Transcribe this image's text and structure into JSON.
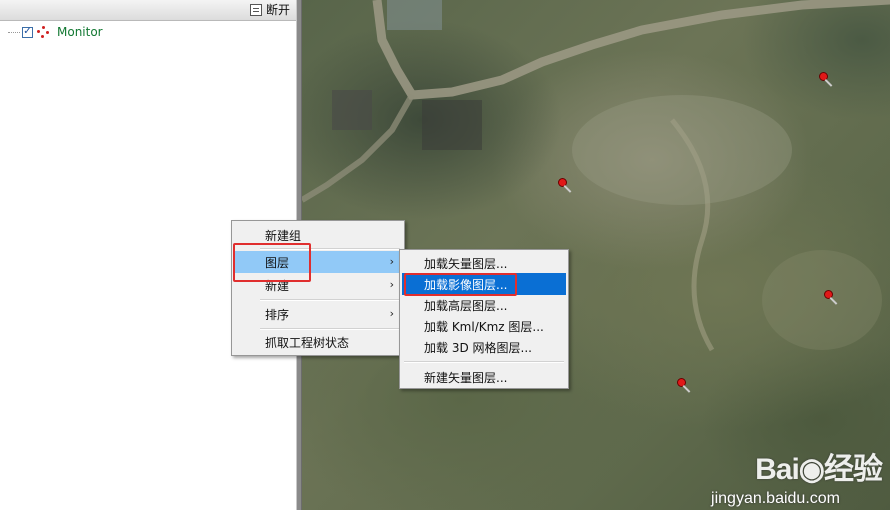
{
  "toolbar": {
    "disconnect_label": "断开"
  },
  "tree": {
    "node_label": "Monitor",
    "checked": true
  },
  "context_menu": {
    "items": [
      {
        "label": "新建组",
        "has_submenu": false
      },
      {
        "label": "图层",
        "has_submenu": true,
        "state": "highlighted"
      },
      {
        "label": "新建",
        "has_submenu": true
      },
      {
        "label": "排序",
        "has_submenu": true
      },
      {
        "label": "抓取工程树状态",
        "has_submenu": false
      }
    ],
    "arrow_glyph": "›"
  },
  "submenu": {
    "items": [
      {
        "label": "加载矢量图层..."
      },
      {
        "label": "加载影像图层...",
        "state": "selected"
      },
      {
        "label": "加载高层图层..."
      },
      {
        "label": "加载 Kml/Kmz 图层..."
      },
      {
        "label": "加载 3D 网格图层..."
      },
      {
        "label": "新建矢量图层..."
      }
    ]
  },
  "watermark": {
    "brand": "Bai◉经验",
    "url": "jingyan.baidu.com"
  },
  "colors": {
    "highlight": "#91c9f7",
    "selected": "#0a6fd4",
    "annotation_box": "#e02e2e",
    "tree_label": "#127832",
    "pin": "#e01818"
  },
  "icons": [
    "table-icon",
    "tree-node-icon",
    "map-pin-icon",
    "submenu-arrow-icon"
  ]
}
